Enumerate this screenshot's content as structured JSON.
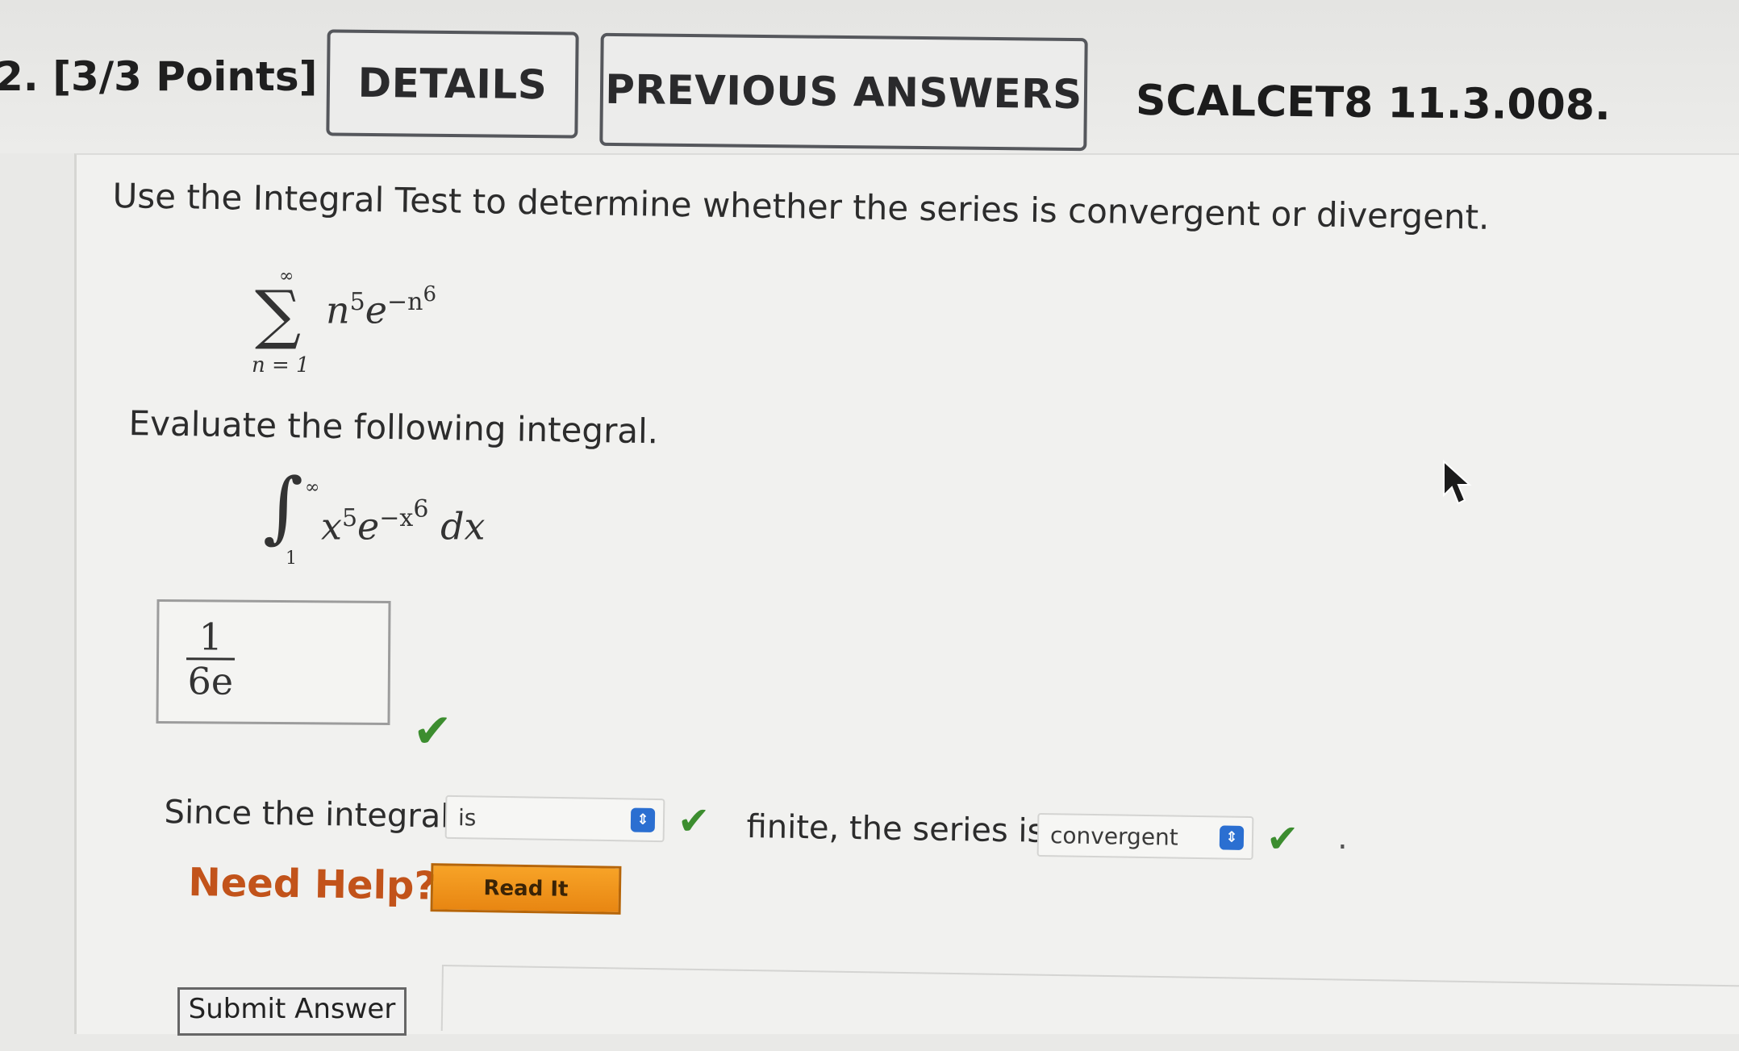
{
  "header": {
    "question_number": "2. [3/3 Points]",
    "details_label": "DETAILS",
    "previous_answers_label": "PREVIOUS ANSWERS",
    "course_code": "SCALCET8 11.3.008."
  },
  "problem": {
    "prompt": "Use the Integral Test to determine whether the series is convergent or divergent.",
    "series": {
      "upper": "∞",
      "sigma": "∑",
      "lower": "n = 1",
      "base1": "n",
      "exp1": "5",
      "base2": "e",
      "exp2_prefix": "−n",
      "exp2_power": "6"
    },
    "evaluate_text": "Evaluate the following integral.",
    "integral": {
      "sign": "∫",
      "upper": "∞",
      "lower": "1",
      "base1": "x",
      "exp1": "5",
      "base2": "e",
      "exp2": "−x",
      "exp2_power": "6",
      "dx": "dx"
    },
    "answer": {
      "numerator": "1",
      "denominator": "6e"
    },
    "since_text": "Since the integral",
    "integral_select_value": "is",
    "finite_text": "finite, the series is",
    "series_select_value": "convergent",
    "period": "."
  },
  "help": {
    "need_help_label": "Need Help?",
    "read_it_label": "Read It"
  },
  "submit_label": "Submit Answer",
  "icons": {
    "check": "✔",
    "select_arrow": "⇕"
  },
  "colors": {
    "check_green": "#3c8d2f",
    "need_help_orange": "#c2531a",
    "read_it_orange": "#f29a1f",
    "select_blue": "#2b6fd1"
  }
}
